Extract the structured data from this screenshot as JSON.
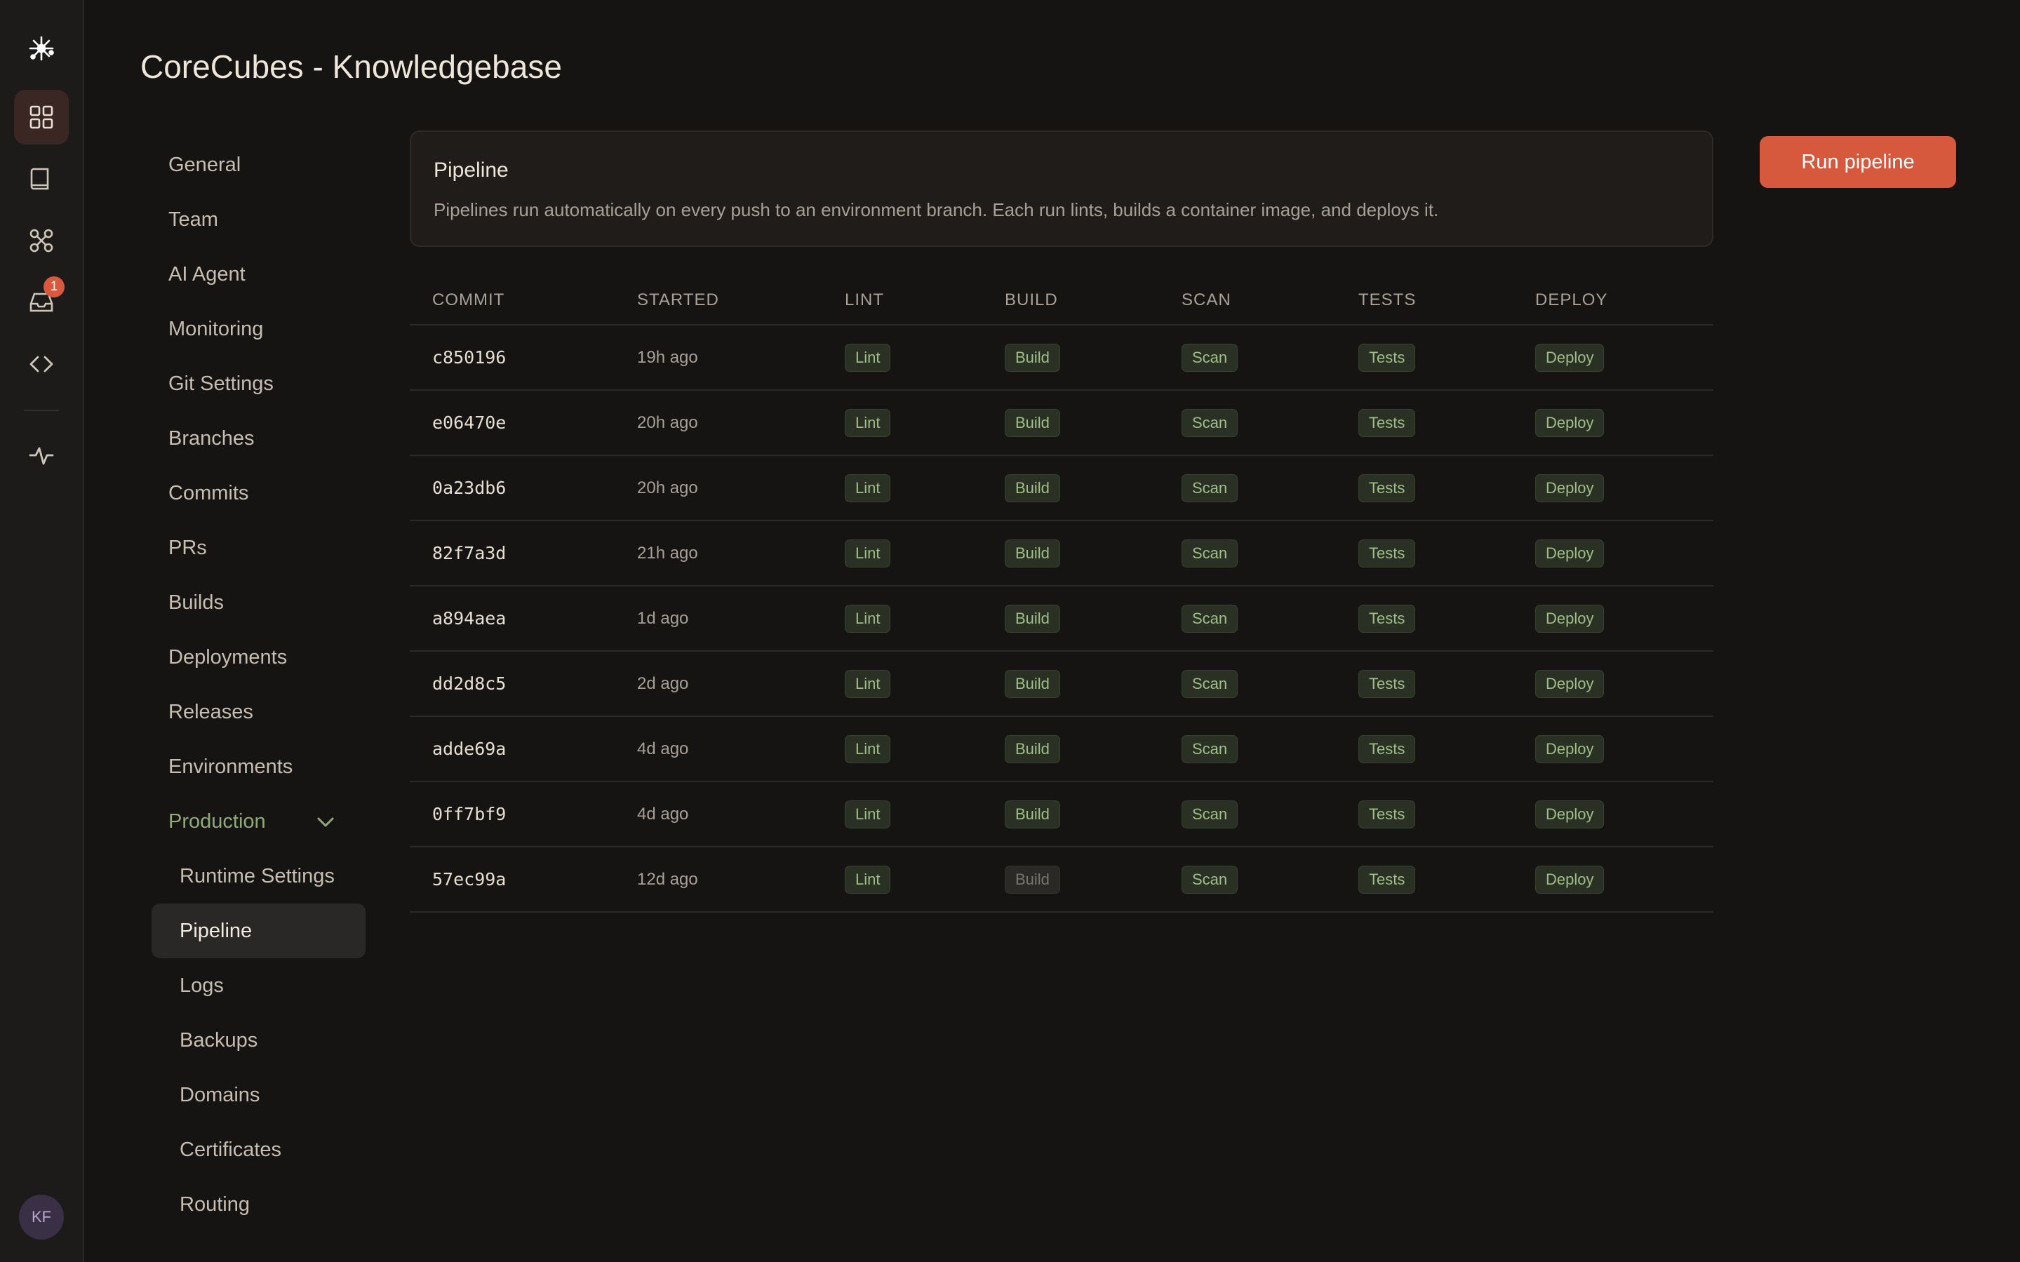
{
  "app": {
    "title": "CoreCubes - Knowledgebase"
  },
  "rail": {
    "items": [
      {
        "icon": "sparkle-logo-icon"
      },
      {
        "icon": "grid-icon",
        "active": true
      },
      {
        "icon": "book-icon"
      },
      {
        "icon": "integrations-icon"
      },
      {
        "icon": "inbox-icon",
        "badge": "1"
      },
      {
        "icon": "code-icon"
      },
      {
        "icon": "activity-icon"
      }
    ],
    "avatar": "KF"
  },
  "nav": {
    "items": [
      {
        "label": "General"
      },
      {
        "label": "Team"
      },
      {
        "label": "AI Agent"
      },
      {
        "label": "Monitoring"
      },
      {
        "label": "Git Settings"
      },
      {
        "label": "Branches"
      },
      {
        "label": "Commits"
      },
      {
        "label": "PRs"
      },
      {
        "label": "Builds"
      },
      {
        "label": "Deployments"
      },
      {
        "label": "Releases"
      },
      {
        "label": "Environments"
      },
      {
        "label": "Production",
        "group": true
      },
      {
        "label": "Runtime Settings",
        "sub": true
      },
      {
        "label": "Pipeline",
        "sub": true,
        "active": true
      },
      {
        "label": "Logs",
        "sub": true
      },
      {
        "label": "Backups",
        "sub": true
      },
      {
        "label": "Domains",
        "sub": true
      },
      {
        "label": "Certificates",
        "sub": true
      },
      {
        "label": "Routing",
        "sub": true
      }
    ]
  },
  "card": {
    "title": "Pipeline",
    "description": "Pipelines run automatically on every push to an environment branch. Each run lints, builds a container image, and deploys it."
  },
  "actions": {
    "run_label": "Run pipeline"
  },
  "table": {
    "columns": [
      "COMMIT",
      "STARTED",
      "LINT",
      "BUILD",
      "SCAN",
      "TESTS",
      "DEPLOY"
    ],
    "rows": [
      {
        "commit": "c850196",
        "started": "19h ago",
        "lint": "Lint",
        "build": "Build",
        "scan": "Scan",
        "tests": "Tests",
        "deploy": "Deploy"
      },
      {
        "commit": "e06470e",
        "started": "20h ago",
        "lint": "Lint",
        "build": "Build",
        "scan": "Scan",
        "tests": "Tests",
        "deploy": "Deploy"
      },
      {
        "commit": "0a23db6",
        "started": "20h ago",
        "lint": "Lint",
        "build": "Build",
        "scan": "Scan",
        "tests": "Tests",
        "deploy": "Deploy"
      },
      {
        "commit": "82f7a3d",
        "started": "21h ago",
        "lint": "Lint",
        "build": "Build",
        "scan": "Scan",
        "tests": "Tests",
        "deploy": "Deploy"
      },
      {
        "commit": "a894aea",
        "started": "1d ago",
        "lint": "Lint",
        "build": "Build",
        "scan": "Scan",
        "tests": "Tests",
        "deploy": "Deploy"
      },
      {
        "commit": "dd2d8c5",
        "started": "2d ago",
        "lint": "Lint",
        "build": "Build",
        "scan": "Scan",
        "tests": "Tests",
        "deploy": "Deploy"
      },
      {
        "commit": "adde69a",
        "started": "4d ago",
        "lint": "Lint",
        "build": "Build",
        "scan": "Scan",
        "tests": "Tests",
        "deploy": "Deploy"
      },
      {
        "commit": "0ff7bf9",
        "started": "4d ago",
        "lint": "Lint",
        "build": "Build",
        "scan": "Scan",
        "tests": "Tests",
        "deploy": "Deploy"
      },
      {
        "commit": "57ec99a",
        "started": "12d ago",
        "lint": "Lint",
        "build": "Build",
        "build_muted": true,
        "scan": "Scan",
        "tests": "Tests",
        "deploy": "Deploy"
      }
    ]
  },
  "colors": {
    "accent": "#d6593e",
    "success_text": "#9fbf86",
    "background": "#151412"
  }
}
